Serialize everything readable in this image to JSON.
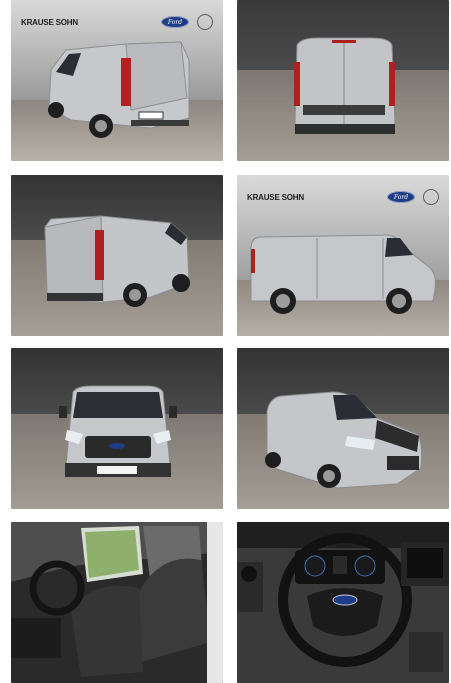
{
  "gallery": {
    "tiles": [
      {
        "name": "photo-rear-three-quarter-left",
        "dealer_logo": "KRAUSE SOHN",
        "brand_logo": "Ford"
      },
      {
        "name": "photo-rear"
      },
      {
        "name": "photo-rear-three-quarter-right"
      },
      {
        "name": "photo-side-right",
        "dealer_logo": "KRAUSE SOHN",
        "brand_logo": "Ford"
      },
      {
        "name": "photo-front"
      },
      {
        "name": "photo-front-three-quarter-right"
      },
      {
        "name": "photo-interior-seats"
      },
      {
        "name": "photo-interior-steering-wheel"
      }
    ]
  },
  "colors": {
    "studio_wall": "#3b3b3b",
    "studio_floor": "#a8a39b",
    "van_body": "#c4c6c9",
    "interior": "#2b2b2b",
    "dealer_accent": "#e0781f",
    "ford_blue": "#1f3c88"
  }
}
